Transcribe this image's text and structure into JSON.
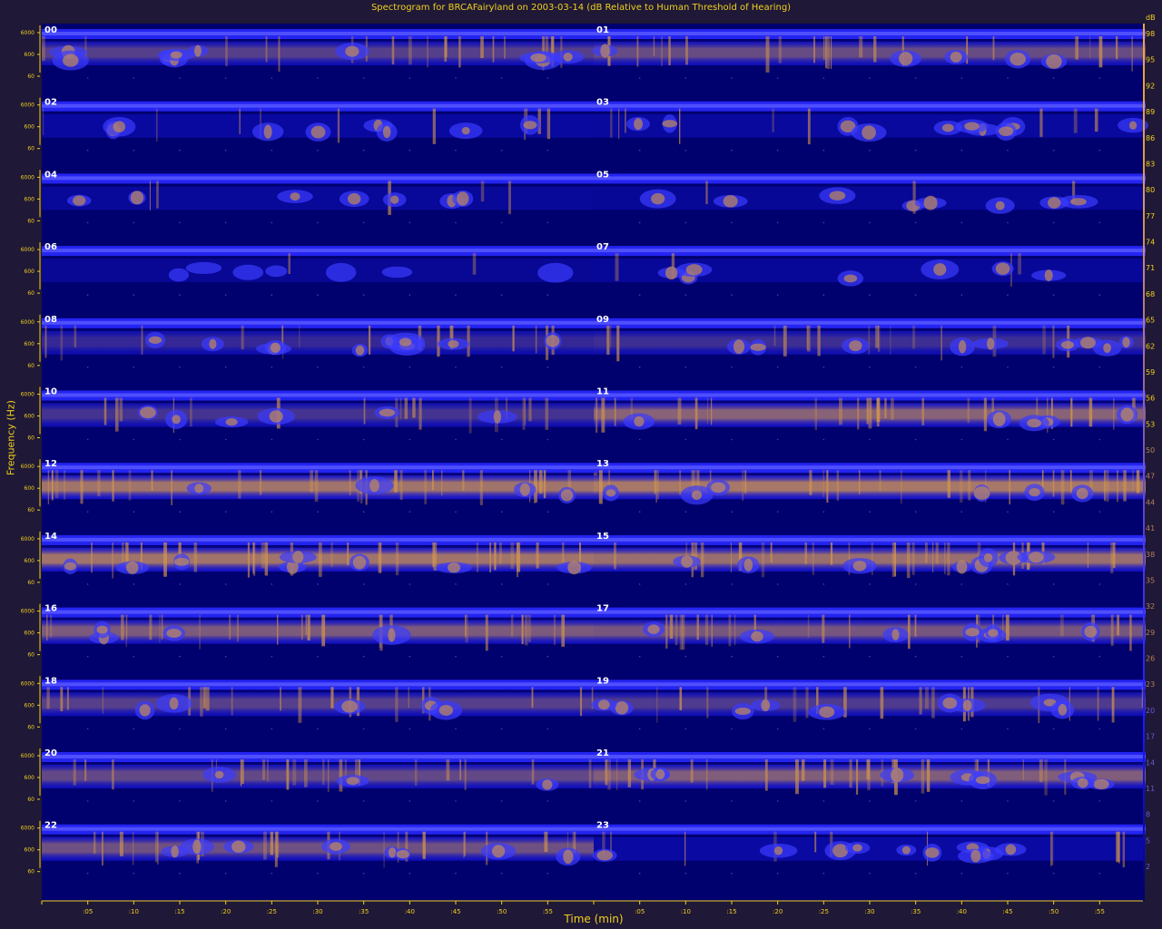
{
  "title": "Spectrogram for BRCAFairyland on 2003-03-14 (dB Relative to Human Threshold of Hearing)",
  "chart_data": {
    "type": "heatmap",
    "title": "Spectrogram for BRCAFairyland on 2003-03-14 (dB Relative to Human Threshold of Hearing)",
    "xlabel": "Time (min)",
    "ylabel": "Frequency (Hz)",
    "x_tick_labels": [
      ":05",
      ":10",
      ":15",
      ":20",
      ":25",
      ":30",
      ":35",
      ":40",
      ":45",
      ":50",
      ":55"
    ],
    "y_tick_labels": [
      "6000",
      "600",
      "60"
    ],
    "colorbar_label": "dB",
    "colorbar_ticks": [
      98,
      95,
      92,
      89,
      86,
      83,
      80,
      77,
      74,
      71,
      68,
      65,
      62,
      59,
      56,
      53,
      50,
      47,
      44,
      41,
      38,
      35,
      32,
      29,
      26,
      23,
      20,
      17,
      14,
      11,
      8,
      5,
      2
    ],
    "colorbar_range": [
      0,
      100
    ],
    "colormap": [
      "#00006e",
      "#1a1aff",
      "#4a3ae0",
      "#9a6a9a",
      "#d89a4a",
      "#f0a830"
    ],
    "hours": [
      {
        "label": "00",
        "intensity": 0.55
      },
      {
        "label": "01",
        "intensity": 0.62
      },
      {
        "label": "02",
        "intensity": 0.25
      },
      {
        "label": "03",
        "intensity": 0.22
      },
      {
        "label": "04",
        "intensity": 0.12
      },
      {
        "label": "05",
        "intensity": 0.08
      },
      {
        "label": "06",
        "intensity": 0.05
      },
      {
        "label": "07",
        "intensity": 0.1
      },
      {
        "label": "08",
        "intensity": 0.42
      },
      {
        "label": "09",
        "intensity": 0.45
      },
      {
        "label": "10",
        "intensity": 0.48
      },
      {
        "label": "11",
        "intensity": 0.75
      },
      {
        "label": "12",
        "intensity": 0.85
      },
      {
        "label": "13",
        "intensity": 0.88
      },
      {
        "label": "14",
        "intensity": 0.85
      },
      {
        "label": "15",
        "intensity": 0.82
      },
      {
        "label": "16",
        "intensity": 0.7
      },
      {
        "label": "17",
        "intensity": 0.68
      },
      {
        "label": "18",
        "intensity": 0.55
      },
      {
        "label": "19",
        "intensity": 0.52
      },
      {
        "label": "20",
        "intensity": 0.6
      },
      {
        "label": "21",
        "intensity": 0.72
      },
      {
        "label": "22",
        "intensity": 0.65
      },
      {
        "label": "23",
        "intensity": 0.3
      }
    ]
  }
}
